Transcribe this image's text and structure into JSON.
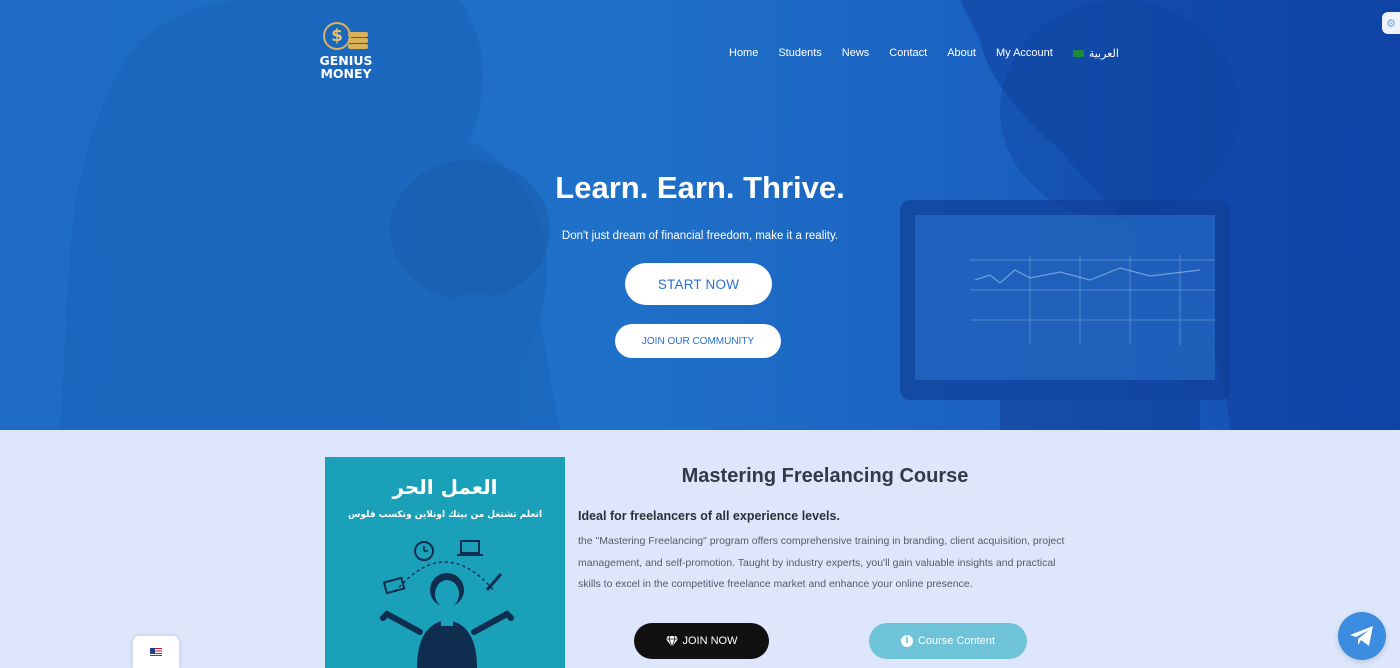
{
  "brand": {
    "logo_line1": "GENIUS",
    "logo_line2": "MONEY",
    "coin_symbol": "$",
    "gold": "#d9b25b"
  },
  "nav": {
    "items": [
      {
        "label": "Home"
      },
      {
        "label": "Students"
      },
      {
        "label": "News"
      },
      {
        "label": "Contact"
      },
      {
        "label": "About"
      },
      {
        "label": "My Account"
      }
    ],
    "language_label": "العربية"
  },
  "hero": {
    "title": "Learn. Earn. Thrive.",
    "subtitle": "Don't just dream of financial freedom, make it a reality.",
    "primary_button": "START NOW",
    "secondary_button": "JOIN OUR COMMUNITY"
  },
  "course": {
    "image_title": "العمل الحر",
    "image_subtitle": "اتعلم تشتغل من بيتك اونلاين وتكسب فلوس",
    "title": "Mastering Freelancing Course",
    "lead": "Ideal for freelancers of all experience levels.",
    "description": "the \"Mastering Freelancing\" program offers comprehensive training in branding, client acquisition, project management, and self-promotion. Taught by industry experts, you'll gain valuable insights and practical skills to excel in the competitive freelance market and enhance your online presence.",
    "join_button": "JOIN NOW",
    "content_button": "Course Content"
  },
  "widgets": {
    "language_flag": "us-flag-icon",
    "chat_icon": "telegram-icon"
  },
  "colors": {
    "hero_blue": "#1e6cc4",
    "section_bg": "#dde6fb",
    "teal": "#1aa0b8",
    "accent_blue": "#2a6fd0"
  }
}
